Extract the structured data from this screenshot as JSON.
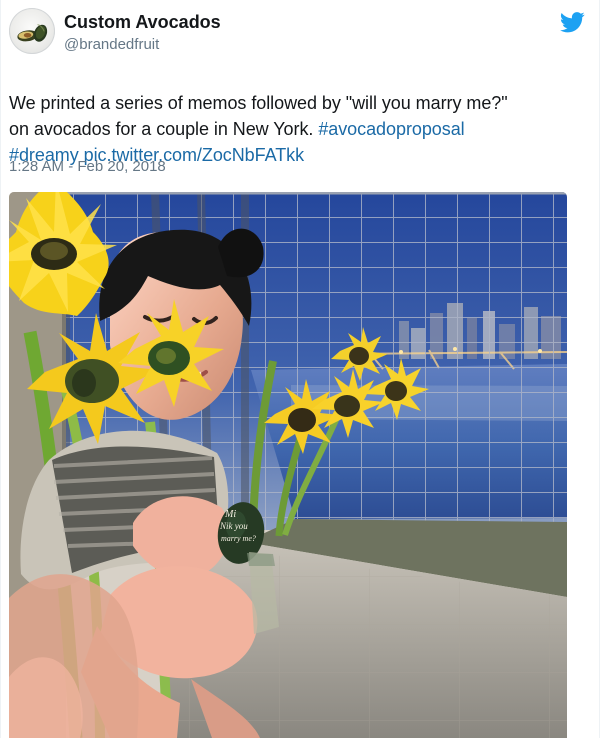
{
  "tweet": {
    "author": {
      "display_name": "Custom Avocados",
      "handle": "@brandedfruit",
      "avatar_icon": "avocado-avatar-icon"
    },
    "brand_icon": "twitter-bird-icon",
    "text": {
      "line_1": "We printed a series of memos followed by \"will you marry me?\"",
      "line_2_prefix": "on avocados for a couple in New York.",
      "hashtag_1": "#avocadoproposal",
      "hashtag_2": "#dreamy",
      "photo_link": "pic.twitter.com/ZocNbFATkk"
    },
    "timestamp": "1:28 AM - Feb 20, 2018",
    "photo": {
      "avocado_text": [
        "Mi",
        "Nik you",
        "marry me?"
      ]
    },
    "colors": {
      "name_text": "#14171a",
      "secondary_text": "#657786",
      "link": "#1b6aa6",
      "twitter_blue": "#1da1f2"
    }
  }
}
